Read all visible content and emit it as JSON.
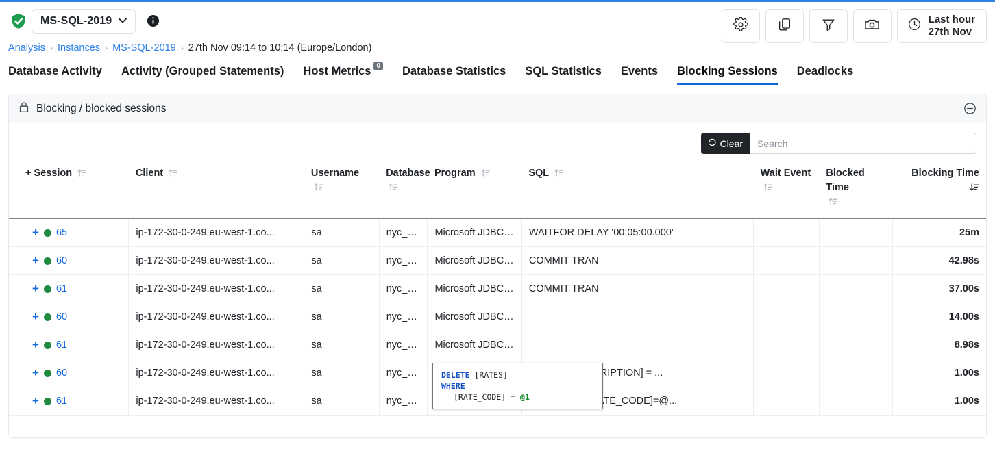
{
  "header": {
    "status_icon": "shield-check-icon",
    "instance_name": "MS-SQL-2019",
    "chevron": "⌄",
    "info_icon": "info-icon",
    "actions": [
      {
        "name": "settings-button",
        "icon": "gear-icon"
      },
      {
        "name": "copy-button",
        "icon": "copy-documents-icon"
      },
      {
        "name": "filter-button",
        "icon": "filter-funnel-icon"
      },
      {
        "name": "snapshot-button",
        "icon": "camera-icon"
      }
    ],
    "time_range": {
      "icon": "clock-icon",
      "line1": "Last hour",
      "line2": "27th Nov"
    }
  },
  "breadcrumb": {
    "items": [
      {
        "label": "Analysis",
        "link": true
      },
      {
        "label": "Instances",
        "link": true
      },
      {
        "label": "MS-SQL-2019",
        "link": true
      },
      {
        "label": "27th Nov 09:14 to 10:14 (Europe/London)",
        "link": false
      }
    ],
    "separator": "›"
  },
  "tabs": [
    {
      "label": "Database Activity",
      "active": false
    },
    {
      "label": "Activity (Grouped Statements)",
      "active": false
    },
    {
      "label": "Host Metrics",
      "active": false,
      "badge": "0"
    },
    {
      "label": "Database Statistics",
      "active": false
    },
    {
      "label": "SQL Statistics",
      "active": false
    },
    {
      "label": "Events",
      "active": false
    },
    {
      "label": "Blocking Sessions",
      "active": true
    },
    {
      "label": "Deadlocks",
      "active": false
    }
  ],
  "panel": {
    "icon": "lock-icon",
    "title": "Blocking / blocked sessions",
    "collapse_icon": "minus-circle-icon"
  },
  "toolbar": {
    "clear_label": "Clear",
    "clear_icon": "undo-arrow-icon",
    "search_placeholder": "Search",
    "search_value": ""
  },
  "table": {
    "columns": [
      {
        "label": "+ Session",
        "sort": "asc-inactive",
        "align": "left"
      },
      {
        "label": "Client",
        "sort": "asc-inactive",
        "align": "left"
      },
      {
        "label": "Username",
        "sort": "asc-inactive",
        "align": "left"
      },
      {
        "label": "Database",
        "sort": "asc-inactive",
        "align": "left"
      },
      {
        "label": "Program",
        "sort": "asc-inactive",
        "align": "left"
      },
      {
        "label": "SQL",
        "sort": "asc-inactive",
        "align": "left"
      },
      {
        "label": "Wait Event",
        "sort": "asc-inactive",
        "align": "left"
      },
      {
        "label": "Blocked Time",
        "sort": "asc-inactive",
        "align": "left"
      },
      {
        "label": "Blocking Time",
        "sort": "desc-active",
        "align": "right"
      }
    ],
    "rows": [
      {
        "expander": "+",
        "status": "green",
        "session": "65",
        "client": "ip-172-30-0-249.eu-west-1.co...",
        "username": "sa",
        "database": "nyc_data",
        "program": "Microsoft JDBC ...",
        "sql": "WAITFOR DELAY '00:05:00.000'",
        "wait_event": "",
        "blocked_time": "",
        "blocking_time": "25m"
      },
      {
        "expander": "+",
        "status": "green",
        "session": "60",
        "client": "ip-172-30-0-249.eu-west-1.co...",
        "username": "sa",
        "database": "nyc_data",
        "program": "Microsoft JDBC ...",
        "sql": "COMMIT TRAN",
        "wait_event": "",
        "blocked_time": "",
        "blocking_time": "42.98s"
      },
      {
        "expander": "+",
        "status": "green",
        "session": "61",
        "client": "ip-172-30-0-249.eu-west-1.co...",
        "username": "sa",
        "database": "nyc_data",
        "program": "Microsoft JDBC ...",
        "sql": "COMMIT TRAN",
        "wait_event": "",
        "blocked_time": "",
        "blocking_time": "37.00s"
      },
      {
        "expander": "+",
        "status": "green",
        "session": "60",
        "client": "ip-172-30-0-249.eu-west-1.co...",
        "username": "sa",
        "database": "nyc_data",
        "program": "Microsoft JDBC ...",
        "sql": "",
        "wait_event": "",
        "blocked_time": "",
        "blocking_time": "14.00s"
      },
      {
        "expander": "+",
        "status": "green",
        "session": "61",
        "client": "ip-172-30-0-249.eu-west-1.co...",
        "username": "sa",
        "database": "nyc_data",
        "program": "Microsoft JDBC ...",
        "sql": "",
        "wait_event": "",
        "blocked_time": "",
        "blocking_time": "8.98s"
      },
      {
        "expander": "+",
        "status": "green",
        "session": "60",
        "client": "ip-172-30-0-249.eu-west-1.co...",
        "username": "sa",
        "database": "nyc_data",
        "program": "",
        "sql": "TES] set [DESCRIPTION] = ...",
        "wait_event": "",
        "blocked_time": "",
        "blocking_time": "1.00s"
      },
      {
        "expander": "+",
        "status": "green",
        "session": "61",
        "client": "ip-172-30-0-249.eu-west-1.co...",
        "username": "sa",
        "database": "nyc_data",
        "program": "",
        "sql": "ES] WHERE [RATE_CODE]=@...",
        "wait_event": "",
        "blocked_time": "",
        "blocking_time": "1.00s"
      }
    ]
  },
  "tooltip": {
    "line1_kw": "DELETE",
    "line1_rest": "[RATES]",
    "line2_kw": "WHERE",
    "line3_col": "[RATE_CODE] = ",
    "line3_param": "@1"
  },
  "colors": {
    "accent": "#1168d9",
    "link": "#2f81e8",
    "status_green": "#1d8a3e",
    "dark": "#212529"
  }
}
